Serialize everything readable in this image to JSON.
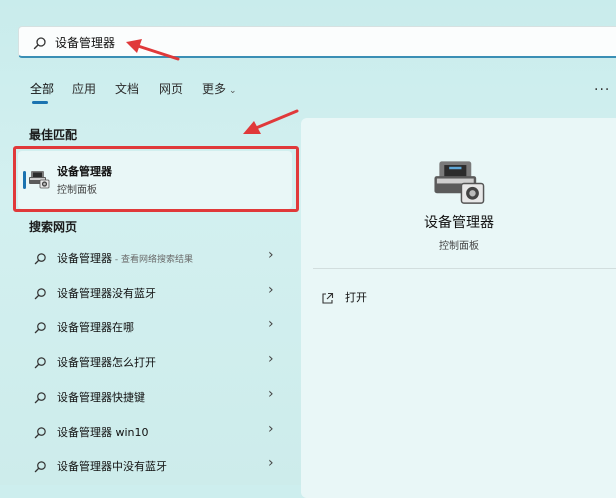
{
  "search": {
    "query": "设备管理器"
  },
  "tabs": [
    {
      "label": "全部"
    },
    {
      "label": "应用"
    },
    {
      "label": "文档"
    },
    {
      "label": "网页"
    },
    {
      "label": "更多"
    }
  ],
  "best_match": {
    "heading": "最佳匹配",
    "title": "设备管理器",
    "subtitle": "控制面板",
    "icon": "device-manager-icon"
  },
  "web": {
    "heading": "搜索网页",
    "items": [
      {
        "label": "设备管理器",
        "note": " - 查看网络搜索结果"
      },
      {
        "label": "设备管理器没有蓝牙",
        "note": ""
      },
      {
        "label": "设备管理器在哪",
        "note": ""
      },
      {
        "label": "设备管理器怎么打开",
        "note": ""
      },
      {
        "label": "设备管理器快捷键",
        "note": ""
      },
      {
        "label": "设备管理器 win10",
        "note": ""
      },
      {
        "label": "设备管理器中没有蓝牙",
        "note": ""
      }
    ]
  },
  "detail": {
    "title": "设备管理器",
    "subtitle": "控制面板",
    "actions": [
      {
        "label": "打开",
        "icon": "open-external-icon"
      }
    ]
  },
  "colors": {
    "accent": "#1a73b0",
    "annotation_red": "#e0393a",
    "background": "#cdeeee",
    "panel": "#e9f7f7"
  }
}
